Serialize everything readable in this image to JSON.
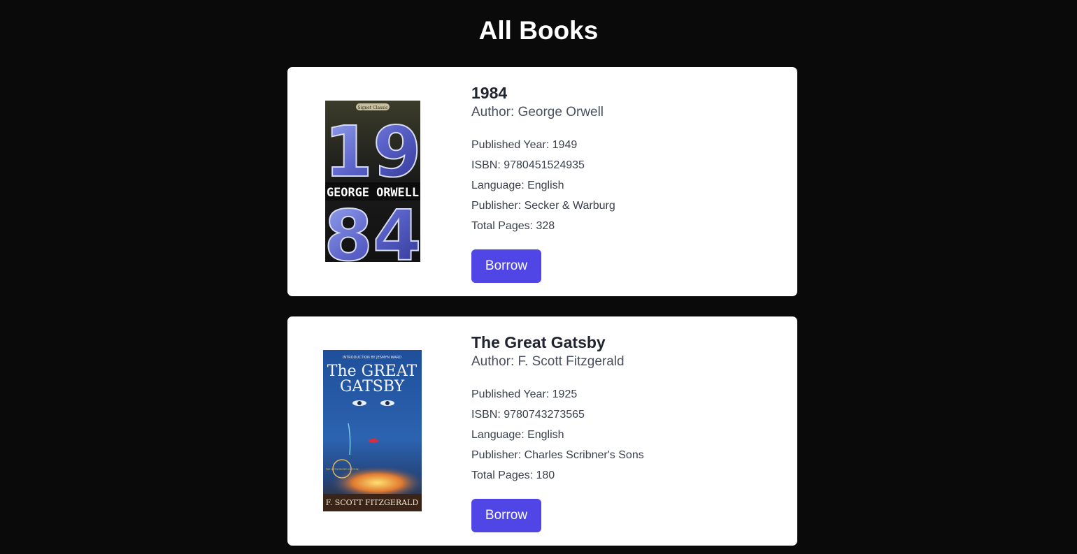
{
  "page": {
    "title": "All Books"
  },
  "books": [
    {
      "title": "1984",
      "author": "Author: George Orwell",
      "details": [
        "Published Year: 1949",
        "ISBN: 9780451524935",
        "Language: English",
        "Publisher: Secker & Warburg",
        "Total Pages: 328"
      ],
      "button_label": "Borrow",
      "cover": {
        "badge_text": "Signet Classic",
        "top_digits": "19",
        "author_band": "GEORGE ORWELL",
        "bottom_digits": "84"
      }
    },
    {
      "title": "The Great Gatsby",
      "author": "Author: F. Scott Fitzgerald",
      "details": [
        "Published Year: 1925",
        "ISBN: 9780743273565",
        "Language: English",
        "Publisher: Charles Scribner's Sons",
        "Total Pages: 180"
      ],
      "button_label": "Borrow",
      "cover": {
        "intro_text": "INTRODUCTION BY JESMYN WARD",
        "title_line_1": "The GREAT",
        "title_line_2": "GATSBY",
        "seal_text": "THE AUTHORIZED EDITION",
        "author_text": "F. SCOTT FITZGERALD"
      }
    }
  ],
  "colors": {
    "background": "#0a0a0a",
    "card": "#ffffff",
    "accent": "#4f46e5"
  }
}
